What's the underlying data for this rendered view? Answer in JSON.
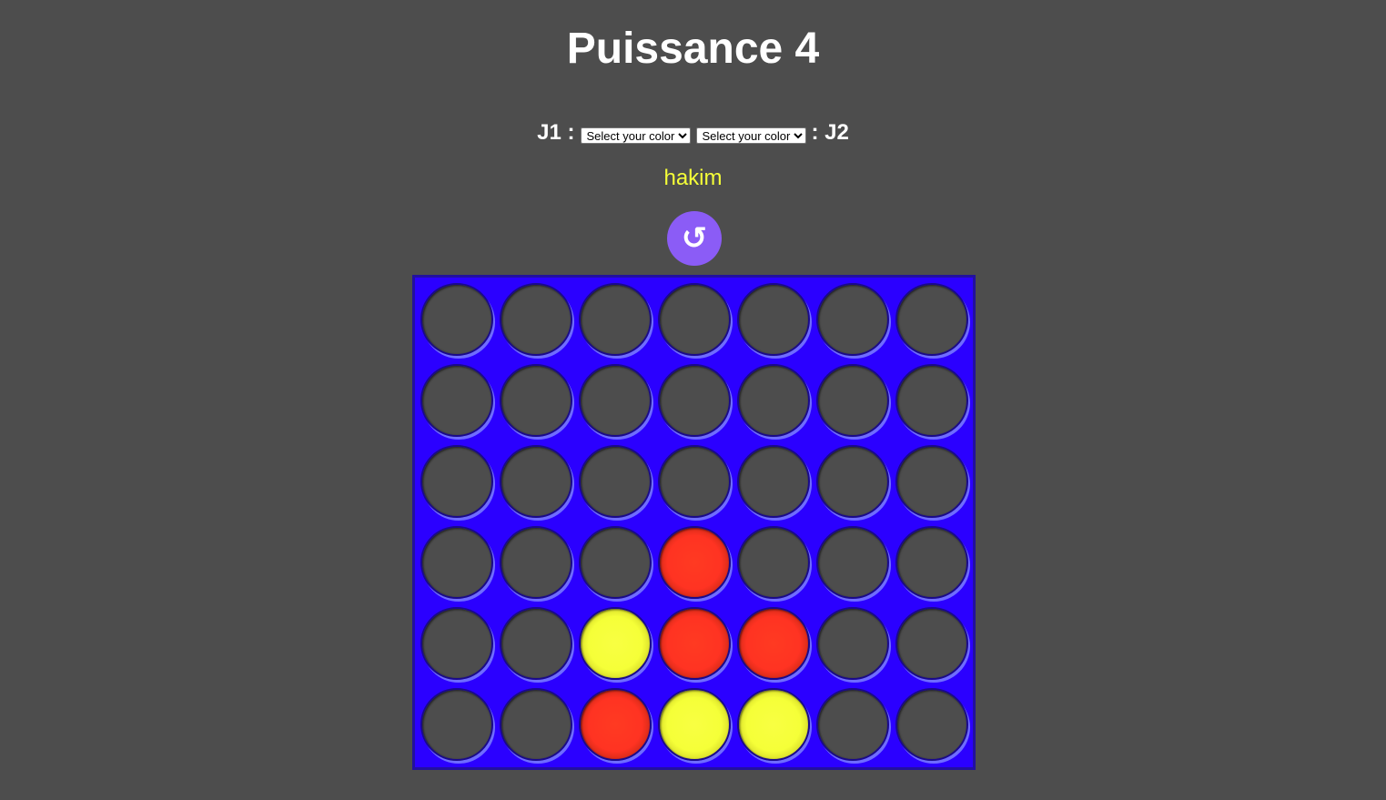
{
  "title": "Puissance 4",
  "players": {
    "j1_label": "J1 :",
    "j2_label": ": J2",
    "j1_select": {
      "selected": "Select your color"
    },
    "j2_select": {
      "selected": "Select your color"
    }
  },
  "turn": {
    "name": "hakim",
    "color": "#f5ff38"
  },
  "reset_button": {
    "icon": "restart-icon",
    "glyph": "↺",
    "color": "#8b5cf6"
  },
  "colors": {
    "background": "#4d4d4d",
    "board": "#2b00ff",
    "red": "#ff3322",
    "yellow": "#f5ff38"
  },
  "board": {
    "rows": 6,
    "columns": 7,
    "cells": [
      [
        "empty",
        "empty",
        "empty",
        "empty",
        "empty",
        "empty",
        "empty"
      ],
      [
        "empty",
        "empty",
        "empty",
        "empty",
        "empty",
        "empty",
        "empty"
      ],
      [
        "empty",
        "empty",
        "empty",
        "empty",
        "empty",
        "empty",
        "empty"
      ],
      [
        "empty",
        "empty",
        "empty",
        "red",
        "empty",
        "empty",
        "empty"
      ],
      [
        "empty",
        "empty",
        "yellow",
        "red",
        "red",
        "empty",
        "empty"
      ],
      [
        "empty",
        "empty",
        "red",
        "yellow",
        "yellow",
        "empty",
        "empty"
      ]
    ]
  }
}
